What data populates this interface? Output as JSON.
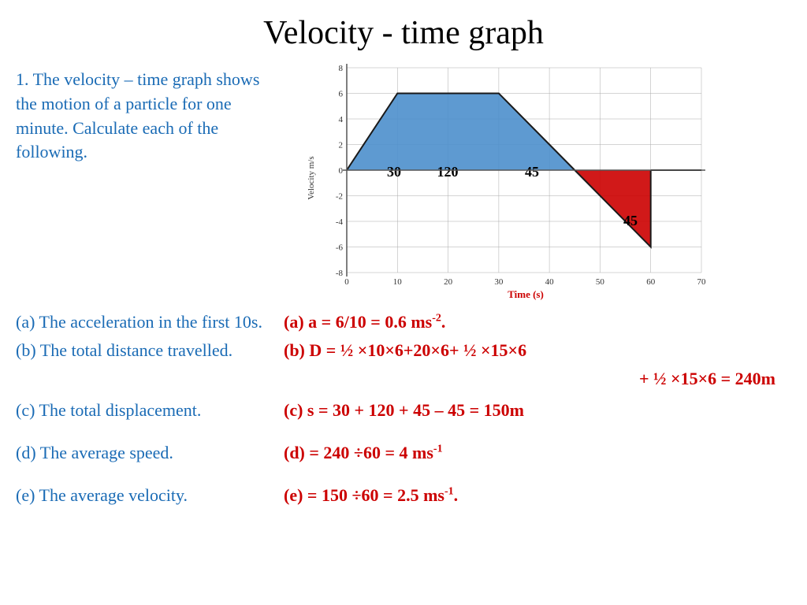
{
  "title": "Velocity -  time graph",
  "problem": {
    "text": "1. The velocity – time graph shows the motion of a particle for one minute. Calculate each of the following."
  },
  "graph": {
    "x_label": "Time (s)",
    "y_label": "Velocity m/s",
    "x_ticks": [
      0,
      10,
      20,
      30,
      40,
      50,
      60,
      70
    ],
    "y_ticks": [
      -8,
      -6,
      -4,
      -2,
      0,
      2,
      4,
      6,
      8
    ],
    "area_labels": [
      "30",
      "120",
      "45"
    ],
    "negative_area_label": "45"
  },
  "qa": [
    {
      "question": "(a) The acceleration in the first 10s.",
      "answer": "(a)  a = 6/10 = 0.6 ms",
      "answer_sup": "-2",
      "answer_suffix": "."
    },
    {
      "question": "(b) The total distance travelled.",
      "answer": "(b) D = ½ ×10×6+20×6+ ½ ×15×6",
      "answer_sup": "",
      "answer_suffix": ""
    },
    {
      "question_b2": "",
      "answer_b2": "+ ½ ×15×6 = 240m"
    },
    {
      "question": "(c) The total displacement.",
      "answer": "(c) s = 30 + 120 + 45 – 45 = 150m",
      "answer_sup": "",
      "answer_suffix": ""
    },
    {
      "question": "(d) The average speed.",
      "answer": "(d)  = 240 ÷60 = 4 ms",
      "answer_sup": "-1",
      "answer_suffix": ""
    },
    {
      "question": "(e) The average velocity.",
      "answer": "(e)  = 150 ÷60 = 2.5 ms",
      "answer_sup": "-1",
      "answer_suffix": "."
    }
  ]
}
